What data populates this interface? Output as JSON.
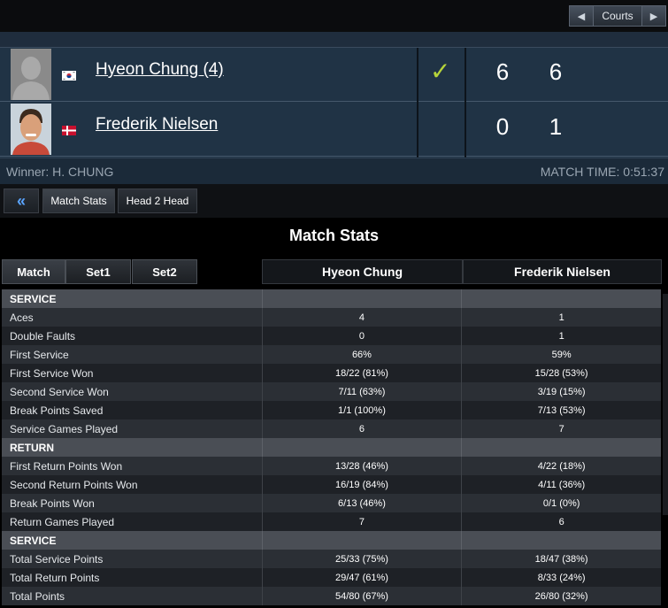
{
  "courts": {
    "label": "Courts",
    "prev_icon": "arrow-left-icon",
    "next_icon": "arrow-right-icon"
  },
  "players": [
    {
      "name": "Hyeon Chung (4)",
      "flag": "south-korea-flag",
      "sets": [
        "6",
        "6"
      ],
      "winner_mark": "✓"
    },
    {
      "name": "Frederik Nielsen",
      "flag": "denmark-flag",
      "sets": [
        "0",
        "1"
      ],
      "winner_mark": ""
    }
  ],
  "winner_text": "Winner: H. CHUNG",
  "match_time": "MATCH TIME: 0:51:37",
  "tabs": {
    "back": "«",
    "match_stats": "Match Stats",
    "head2head": "Head 2 Head"
  },
  "stats": {
    "title": "Match Stats",
    "set_tabs": [
      "Match",
      "Set1",
      "Set2"
    ],
    "col_p1": "Hyeon Chung",
    "col_p2": "Frederik Nielsen",
    "rows": [
      {
        "type": "section",
        "label": "SERVICE",
        "p1": "",
        "p2": ""
      },
      {
        "type": "stat",
        "label": "Aces",
        "p1": "4",
        "p2": "1"
      },
      {
        "type": "stat",
        "label": "Double Faults",
        "p1": "0",
        "p2": "1"
      },
      {
        "type": "stat",
        "label": "First Service",
        "p1": "66%",
        "p2": "59%"
      },
      {
        "type": "stat",
        "label": "First Service Won",
        "p1": "18/22 (81%)",
        "p2": "15/28 (53%)"
      },
      {
        "type": "stat",
        "label": "Second Service Won",
        "p1": "7/11 (63%)",
        "p2": "3/19 (15%)"
      },
      {
        "type": "stat",
        "label": "Break Points Saved",
        "p1": "1/1 (100%)",
        "p2": "7/13 (53%)"
      },
      {
        "type": "stat",
        "label": "Service Games Played",
        "p1": "6",
        "p2": "7"
      },
      {
        "type": "section",
        "label": "RETURN",
        "p1": "",
        "p2": ""
      },
      {
        "type": "stat",
        "label": "First Return Points Won",
        "p1": "13/28 (46%)",
        "p2": "4/22 (18%)"
      },
      {
        "type": "stat",
        "label": "Second Return Points Won",
        "p1": "16/19 (84%)",
        "p2": "4/11 (36%)"
      },
      {
        "type": "stat",
        "label": "Break Points Won",
        "p1": "6/13 (46%)",
        "p2": "0/1 (0%)"
      },
      {
        "type": "stat",
        "label": "Return Games Played",
        "p1": "7",
        "p2": "6"
      },
      {
        "type": "section",
        "label": "SERVICE",
        "p1": "",
        "p2": ""
      },
      {
        "type": "stat",
        "label": "Total Service Points",
        "p1": "25/33 (75%)",
        "p2": "18/47 (38%)"
      },
      {
        "type": "stat",
        "label": "Total Return Points",
        "p1": "29/47 (61%)",
        "p2": "8/33 (24%)"
      },
      {
        "type": "stat",
        "label": "Total Points",
        "p1": "54/80 (67%)",
        "p2": "26/80 (32%)"
      }
    ]
  }
}
